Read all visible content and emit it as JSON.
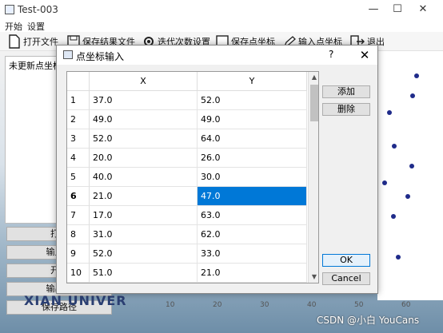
{
  "window": {
    "title": "Test-003"
  },
  "menu": {
    "items": [
      "开始",
      "设置"
    ]
  },
  "toolbar": {
    "open_file": "打开文件",
    "save_result": "保存结果文件",
    "iter_settings": "迭代次数设置",
    "save_points": "保存点坐标",
    "input_points": "输入点坐标",
    "exit": "退出"
  },
  "left_panel": {
    "text": "未更新点坐标",
    "buttons": [
      "打开",
      "输入点",
      "开始",
      "输出规",
      "保存路径"
    ],
    "logo_text": "XIAN UNIVER"
  },
  "plot": {
    "x_ticks": [
      "10",
      "20",
      "30",
      "40",
      "50",
      "60"
    ],
    "point_color": "#1f2b8a"
  },
  "watermark": "CSDN @小白 YouCans",
  "dialog": {
    "title": "点坐标输入",
    "help": "?",
    "columns": [
      "X",
      "Y"
    ],
    "rows": [
      {
        "n": "1",
        "x": "37.0",
        "y": "52.0"
      },
      {
        "n": "2",
        "x": "49.0",
        "y": "49.0"
      },
      {
        "n": "3",
        "x": "52.0",
        "y": "64.0"
      },
      {
        "n": "4",
        "x": "20.0",
        "y": "26.0"
      },
      {
        "n": "5",
        "x": "40.0",
        "y": "30.0"
      },
      {
        "n": "6",
        "x": "21.0",
        "y": "47.0"
      },
      {
        "n": "7",
        "x": "17.0",
        "y": "63.0"
      },
      {
        "n": "8",
        "x": "31.0",
        "y": "62.0"
      },
      {
        "n": "9",
        "x": "52.0",
        "y": "33.0"
      },
      {
        "n": "10",
        "x": "51.0",
        "y": "21.0"
      }
    ],
    "selected_row": 6,
    "add_label": "添加",
    "delete_label": "删除",
    "ok_label": "OK",
    "cancel_label": "Cancel"
  },
  "colors": {
    "selection": "#0078d7"
  }
}
